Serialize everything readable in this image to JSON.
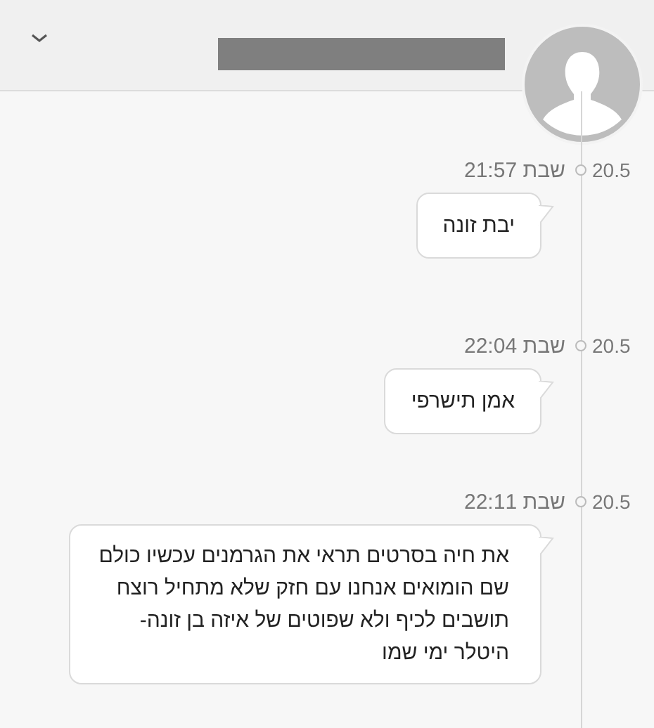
{
  "header": {
    "name_redacted": true
  },
  "messages": [
    {
      "date": "20.5",
      "time": "שבת 21:57",
      "text": "יבת זונה"
    },
    {
      "date": "20.5",
      "time": "שבת 22:04",
      "text": "אמן תישרפי"
    },
    {
      "date": "20.5",
      "time": "שבת 22:11",
      "text": "את חיה בסרטים תראי את הגרמנים עכשיו כולם שם הומואים אנחנו עם חזק שלא מתחיל רוצח תושבים לכיף ולא שפוטים של איזה בן זונה- היטלר ימי שמו"
    }
  ]
}
